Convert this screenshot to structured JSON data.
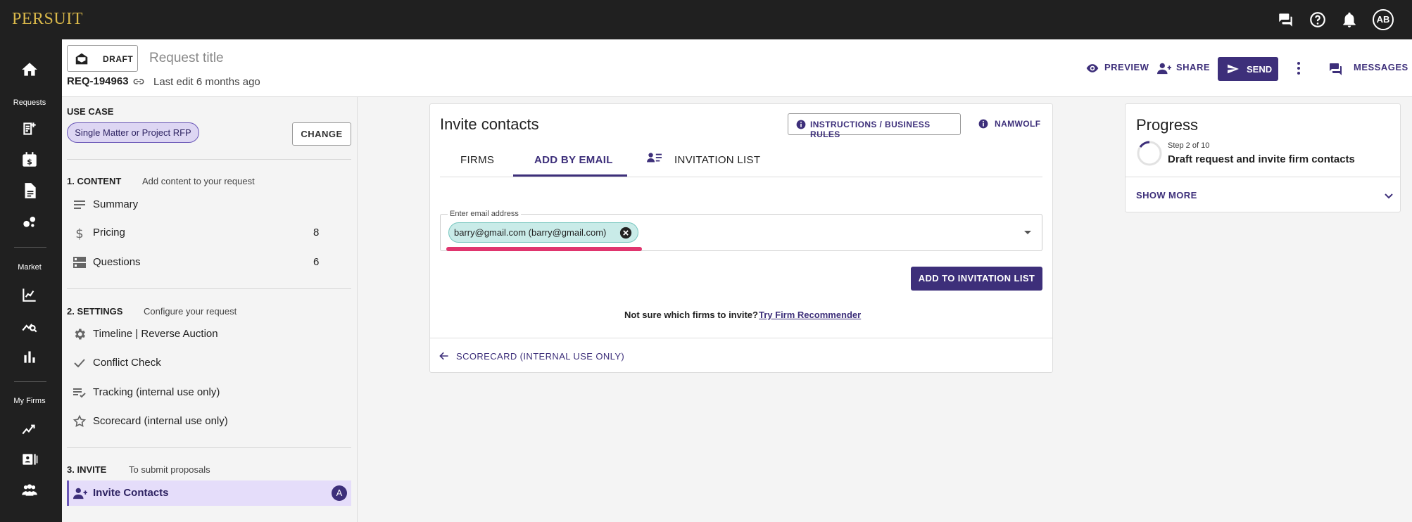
{
  "topbar": {
    "logo": "PERSUIT",
    "icons": [
      "chat-icon",
      "help-icon",
      "bell-icon"
    ],
    "avatar": "AB"
  },
  "rail": {
    "sections": [
      {
        "label": "Requests"
      },
      {
        "label": "Market"
      },
      {
        "label": "My Firms"
      }
    ],
    "icons": [
      "home-icon",
      "new-request-icon",
      "calendar-dollar-icon",
      "document-icon",
      "bubbles-icon",
      "chart-line-icon",
      "search-analytics-icon",
      "bar-chart-icon",
      "trend-icon",
      "contact-card-icon",
      "group-icon"
    ]
  },
  "header": {
    "status": "DRAFT",
    "title_placeholder": "Request title",
    "request_id": "REQ-194963",
    "last_edit": "Last edit 6 months ago",
    "actions": {
      "preview": "PREVIEW",
      "share": "SHARE",
      "send": "SEND",
      "messages": "MESSAGES"
    }
  },
  "sidebar": {
    "use_case": {
      "title": "USE CASE",
      "value": "Single Matter or Project RFP",
      "change": "CHANGE"
    },
    "content": {
      "title": "1. CONTENT",
      "subtitle": "Add content to your request",
      "items": [
        {
          "label": "Summary",
          "count": ""
        },
        {
          "label": "Pricing",
          "count": "8"
        },
        {
          "label": "Questions",
          "count": "6"
        }
      ]
    },
    "settings": {
      "title": "2. SETTINGS",
      "subtitle": "Configure your request",
      "items": [
        {
          "label": "Timeline | Reverse Auction"
        },
        {
          "label": "Conflict Check"
        },
        {
          "label": "Tracking (internal use only)"
        },
        {
          "label": "Scorecard (internal use only)"
        }
      ]
    },
    "invite": {
      "title": "3. INVITE",
      "subtitle": "To submit proposals",
      "items": [
        {
          "label": "Invite Contacts",
          "badge": "A"
        }
      ]
    }
  },
  "main": {
    "title": "Invite contacts",
    "buttons": {
      "instructions": "INSTRUCTIONS / BUSINESS RULES",
      "namwolf": "NAMWOLF"
    },
    "tabs": [
      {
        "label": "FIRMS"
      },
      {
        "label": "ADD BY EMAIL"
      },
      {
        "label": "INVITATION LIST"
      }
    ],
    "active_tab": "ADD BY EMAIL",
    "email_field": {
      "label": "Enter email address",
      "chips": [
        "barry@gmail.com (barry@gmail.com)"
      ]
    },
    "add_button": "ADD TO INVITATION LIST",
    "not_sure": "Not sure which firms to invite?",
    "recommender_link": "Try Firm Recommender",
    "back_link": "SCORECARD (INTERNAL USE ONLY)"
  },
  "progress": {
    "title": "Progress",
    "step": "Step 2 of 10",
    "current": "Draft request and invite firm contacts",
    "show_more": "SHOW MORE"
  },
  "colors": {
    "accent": "#3d2f7a",
    "topbar": "#202020",
    "logo": "#d9b84a",
    "chip": "#c9ebe8",
    "highlight": "#e0356e"
  }
}
